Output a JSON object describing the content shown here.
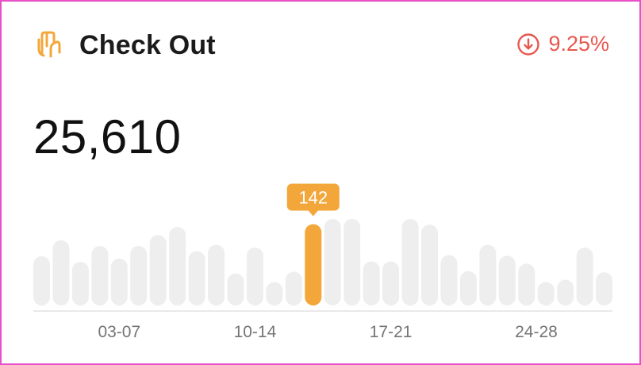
{
  "card": {
    "title": "Check Out",
    "change": "9.25%",
    "change_icon": "arrow-down-circle-icon",
    "title_icon": "credit-card-hand-icon",
    "value": "25,610"
  },
  "colors": {
    "accent": "#f3a73a",
    "negative": "#e8574f",
    "bar": "#eeeeee",
    "axis": "#e2e2e2",
    "tick": "#757575"
  },
  "chart_data": {
    "type": "bar",
    "highlight_index": 14,
    "tooltip": "142",
    "values": [
      86,
      114,
      76,
      104,
      82,
      104,
      123,
      137,
      95,
      106,
      56,
      101,
      41,
      59,
      142,
      151,
      151,
      77,
      77,
      151,
      141,
      88,
      60,
      106,
      87,
      73,
      41,
      45,
      101,
      58
    ],
    "x_ticks": [
      {
        "label": "03-07",
        "index": 4
      },
      {
        "label": "10-14",
        "index": 11
      },
      {
        "label": "17-21",
        "index": 18
      },
      {
        "label": "24-28",
        "index": 25.5
      }
    ],
    "ylim": [
      0,
      180
    ]
  }
}
